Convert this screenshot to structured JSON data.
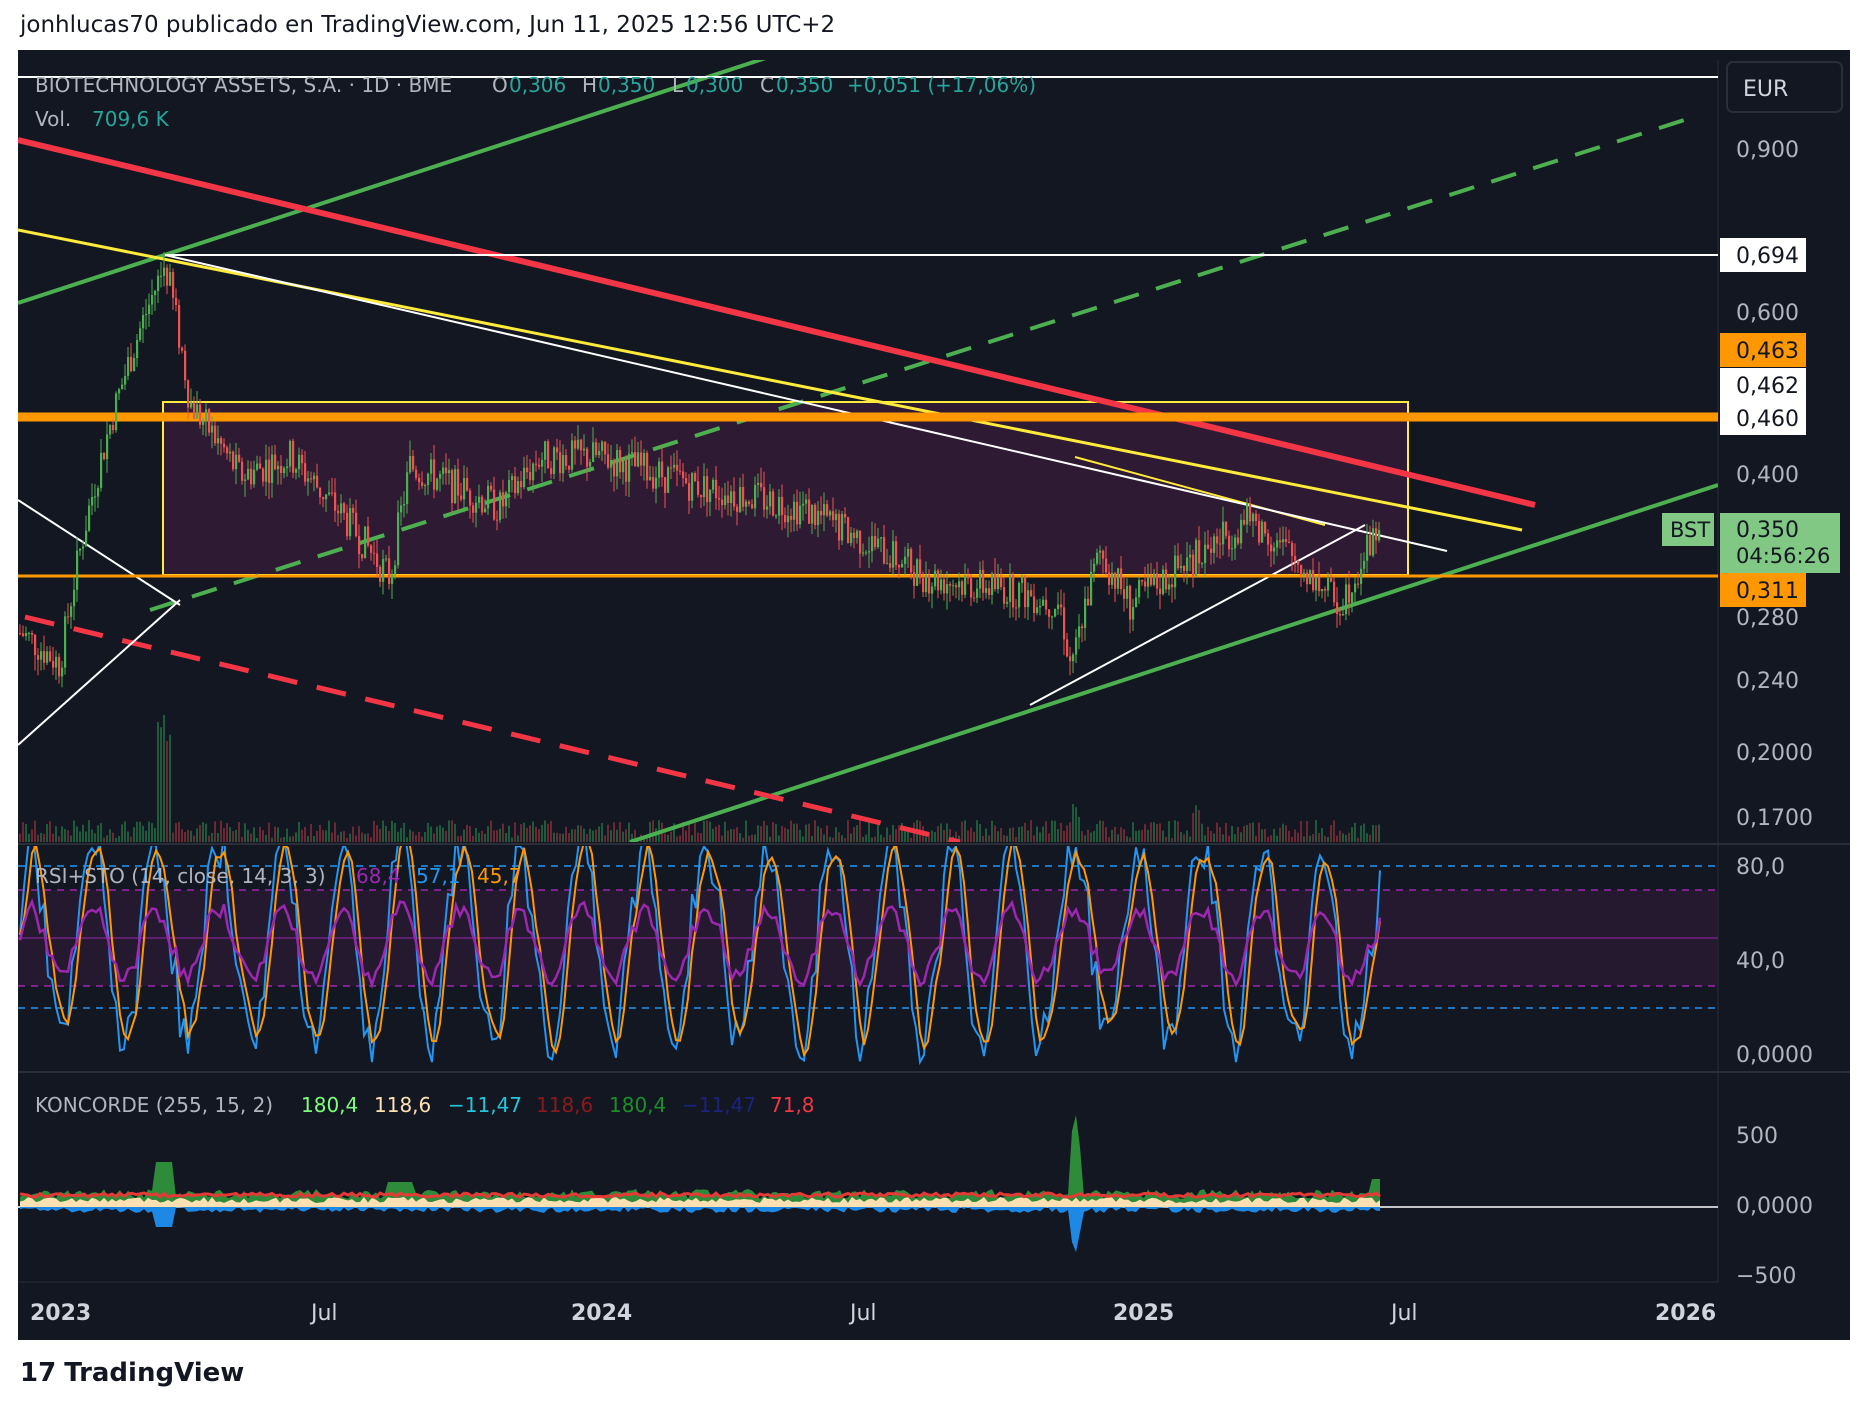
{
  "header": {
    "attribution": "jonhlucas70 publicado en TradingView.com, Jun 11, 2025 12:56 UTC+2"
  },
  "footer": {
    "brand": "TradingView",
    "logo_glyph": "17"
  },
  "colors": {
    "background": "#131722",
    "green_line": "#4caf50",
    "red_line": "#f23645",
    "yellow_line": "#ffeb3b",
    "orange_line": "#ff9800",
    "purple_zone": "#3c1d3a",
    "candle_up": "#4caf50",
    "candle_down": "#ef5350"
  },
  "main_pane": {
    "symbol_line": {
      "symbol": "BIOTECHNOLOGY ASSETS, S.A. · 1D · BME",
      "o_label": "O",
      "o_value": "0,306",
      "h_label": "H",
      "h_value": "0,350",
      "l_label": "L",
      "l_value": "0,300",
      "c_label": "C",
      "c_value": "0,350",
      "change": "+0,051 (+17,06%)"
    },
    "volume_label": "Vol.",
    "volume_value": "709,6 K",
    "currency": "EUR",
    "price_axis_ticks": [
      "0,900",
      "0,600",
      "0,400",
      "0,280",
      "0,240",
      "0,2000",
      "0,1700"
    ],
    "price_badges": [
      {
        "text": "0,694",
        "style": "white"
      },
      {
        "text": "0,463",
        "style": "orange"
      },
      {
        "text": "0,462",
        "style": "white"
      },
      {
        "text": "0,460",
        "style": "white"
      },
      {
        "text": "0,311",
        "style": "orange"
      }
    ],
    "last_price": {
      "ticker": "BST",
      "price": "0,350",
      "countdown": "04:56:26"
    }
  },
  "rsi_pane": {
    "title": "RSI+STO (14, close, 14, 3, 3)",
    "v1": "68,4",
    "v2": "57,1",
    "v3": "45,7",
    "axis_ticks": [
      "80,0",
      "40,0",
      "0,0000"
    ]
  },
  "koncorde_pane": {
    "title": "KONCORDE (255, 15, 2)",
    "values": [
      "180,4",
      "118,6",
      "−11,47",
      "118,6",
      "180,4",
      "−11,47",
      "71,8"
    ],
    "value_colors": [
      "#7cff7c",
      "#ffe0b2",
      "#26c6da",
      "#8b1a1a",
      "#1b8f2a",
      "#1a237e",
      "#f23645"
    ],
    "axis_ticks": [
      "500",
      "0,0000",
      "−500"
    ]
  },
  "time_axis": [
    "2023",
    "Jul",
    "2024",
    "Jul",
    "2025",
    "Jul",
    "2026"
  ],
  "chart_data": {
    "type": "line",
    "title": "BIOTECHNOLOGY ASSETS, S.A. · 1D · BME",
    "currency": "EUR",
    "scale": "log",
    "ylim": [
      0.165,
      1.0
    ],
    "x": [
      "2023-01",
      "2023-03",
      "2023-03",
      "2023-04",
      "2023-05",
      "2023-06",
      "2023-08",
      "2023-09",
      "2023-10",
      "2023-11",
      "2024-01",
      "2024-03",
      "2024-05",
      "2024-07",
      "2024-09",
      "2024-10",
      "2024-11",
      "2024-12",
      "2025-01",
      "2025-02",
      "2025-03",
      "2025-04",
      "2025-05",
      "2025-06"
    ],
    "series": [
      {
        "values": [
          0.27,
          0.25,
          0.68,
          0.48,
          0.4,
          0.42,
          0.31,
          0.41,
          0.37,
          0.42,
          0.42,
          0.39,
          0.37,
          0.31,
          0.3,
          0.29,
          0.25,
          0.33,
          0.29,
          0.33,
          0.36,
          0.32,
          0.29,
          0.35
        ]
      }
    ],
    "horizontal_levels": [
      0.694,
      0.463,
      0.462,
      0.46,
      0.311
    ],
    "indicators": {
      "rsi_sto": {
        "values": [
          68.4,
          57.1,
          45.7
        ],
        "levels": [
          80,
          70,
          50,
          30,
          20
        ]
      },
      "koncorde": {
        "values": [
          180.4,
          118.6,
          -11.47,
          118.6,
          180.4,
          -11.47,
          71.8
        ]
      }
    }
  }
}
